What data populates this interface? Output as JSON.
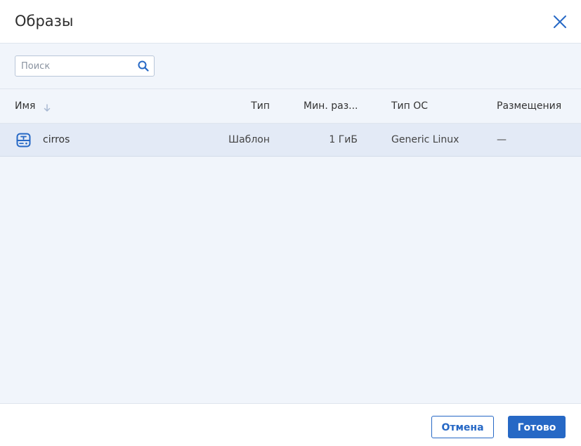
{
  "dialog": {
    "title": "Образы",
    "close_icon": "close-icon"
  },
  "search": {
    "placeholder": "Поиск",
    "value": "",
    "icon": "search-icon"
  },
  "table": {
    "columns": {
      "name": "Имя",
      "type": "Тип",
      "min_size": "Мин. раз...",
      "os_type": "Тип ОС",
      "placements": "Размещения"
    },
    "sort": {
      "column": "name",
      "direction": "descending",
      "icon": "sort-arrow-down-icon"
    },
    "rows": [
      {
        "icon": "template-image-icon",
        "name": "cirros",
        "type": "Шаблон",
        "min_size": "1 ГиБ",
        "os_type": "Generic Linux",
        "placements": "—"
      }
    ]
  },
  "footer": {
    "cancel_label": "Отмена",
    "done_label": "Готово"
  },
  "colors": {
    "accent": "#2668c5",
    "body_bg": "#f1f5fb",
    "selected_row_bg": "#e3eaf6",
    "border": "#dfe5ee"
  }
}
